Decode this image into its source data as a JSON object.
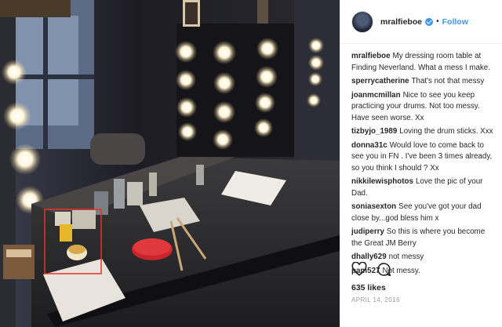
{
  "post": {
    "username": "mralfieboe",
    "follow_label": "Follow",
    "separator": "•",
    "caption_user": "mralfieboe",
    "caption_text": "My dressing room table at Finding Neverland. What a mess I make.",
    "likes": "635 likes",
    "date": "APRIL 14, 2016"
  },
  "comments": [
    {
      "user": "sperrycatherine",
      "text": "That's not that messy"
    },
    {
      "user": "joanmcmillan",
      "text": "Nice to see you keep practicing your drums. Not too messy. Have seen worse. Xx"
    },
    {
      "user": "tizbyjo_1989",
      "text": "Loving the drum sticks. Xxx"
    },
    {
      "user": "donna31c",
      "text": "Would love to come back to see you in FN . I've been 3 times already, so you think I should ? Xx"
    },
    {
      "user": "nikkilewisphotos",
      "text": "Love the pic of your Dad."
    },
    {
      "user": "soniasexton",
      "text": "See you've got your dad close by...god bless him x"
    },
    {
      "user": "judiperry",
      "text": "So this is where you become the Great JM Berry"
    },
    {
      "user": "dhally629",
      "text": "not messy"
    },
    {
      "user": "pam527",
      "text": "Not messy."
    }
  ],
  "icons": {
    "verified": "verified-badge-icon",
    "like": "heart-icon",
    "comment": "comment-bubble-icon"
  },
  "colors": {
    "accent": "#3897f0",
    "text": "#262626",
    "muted": "#999999",
    "highlight_box": "#e8312a"
  }
}
